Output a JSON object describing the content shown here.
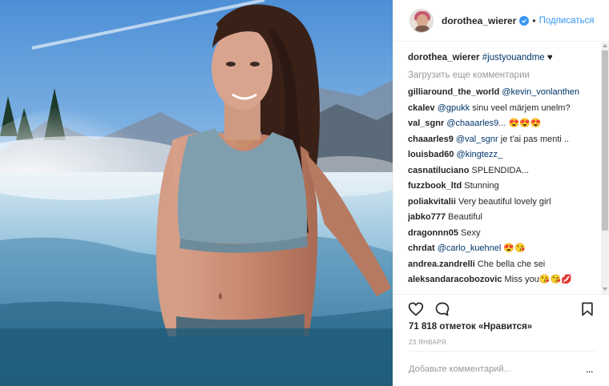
{
  "post": {
    "username": "dorothea_wierer",
    "follow_label": "Подписаться",
    "separator": "•",
    "caption_user": "dorothea_wierer",
    "caption_tag": "#justyouandme",
    "caption_suffix": " ♥",
    "load_more": "Загрузить еще комментарии",
    "likes": "71 818 отметок «Нравится»",
    "date": "23 ЯНВАРЯ",
    "add_comment_placeholder": "Добавьте комментарий...",
    "more_label": "...",
    "comments": [
      {
        "user": "gilliaround_the_world",
        "mention": "@kevin_vonlanthen",
        "text": ""
      },
      {
        "user": "ckalev",
        "mention": "@gpukk",
        "text": " sinu veel märjem unelm?"
      },
      {
        "user": "val_sgnr",
        "mention": "@chaaarles9",
        "text": "... 😍😍😍"
      },
      {
        "user": "chaaarles9",
        "mention": "@val_sgnr",
        "text": " je t'ai pas menti .."
      },
      {
        "user": "louisbad60",
        "mention": "@kingtezz_",
        "text": ""
      },
      {
        "user": "casnatiluciano",
        "mention": "",
        "text": "SPLENDIDA..."
      },
      {
        "user": "fuzzbook_ltd",
        "mention": "",
        "text": "Stunning"
      },
      {
        "user": "poliakvitalii",
        "mention": "",
        "text": "Very beautiful lovely girl"
      },
      {
        "user": "jabko777",
        "mention": "",
        "text": "Beautiful"
      },
      {
        "user": "dragonnn05",
        "mention": "",
        "text": "Sexy"
      },
      {
        "user": "chrdat",
        "mention": "@carlo_kuehnel",
        "text": " 😍😘"
      },
      {
        "user": "andrea.zandrelli",
        "mention": "",
        "text": "Che bella che sei"
      },
      {
        "user": "aleksandaracobozovic",
        "mention": "",
        "text": "Miss you😘😘💋"
      }
    ]
  },
  "icons": {
    "like": "heart-icon",
    "comment": "comment-bubble-icon",
    "save": "bookmark-icon",
    "verified": "verified-badge-icon"
  },
  "colors": {
    "link_blue": "#3897f0",
    "mention_blue": "#003569",
    "muted_gray": "#999999",
    "text_dark": "#262626"
  }
}
